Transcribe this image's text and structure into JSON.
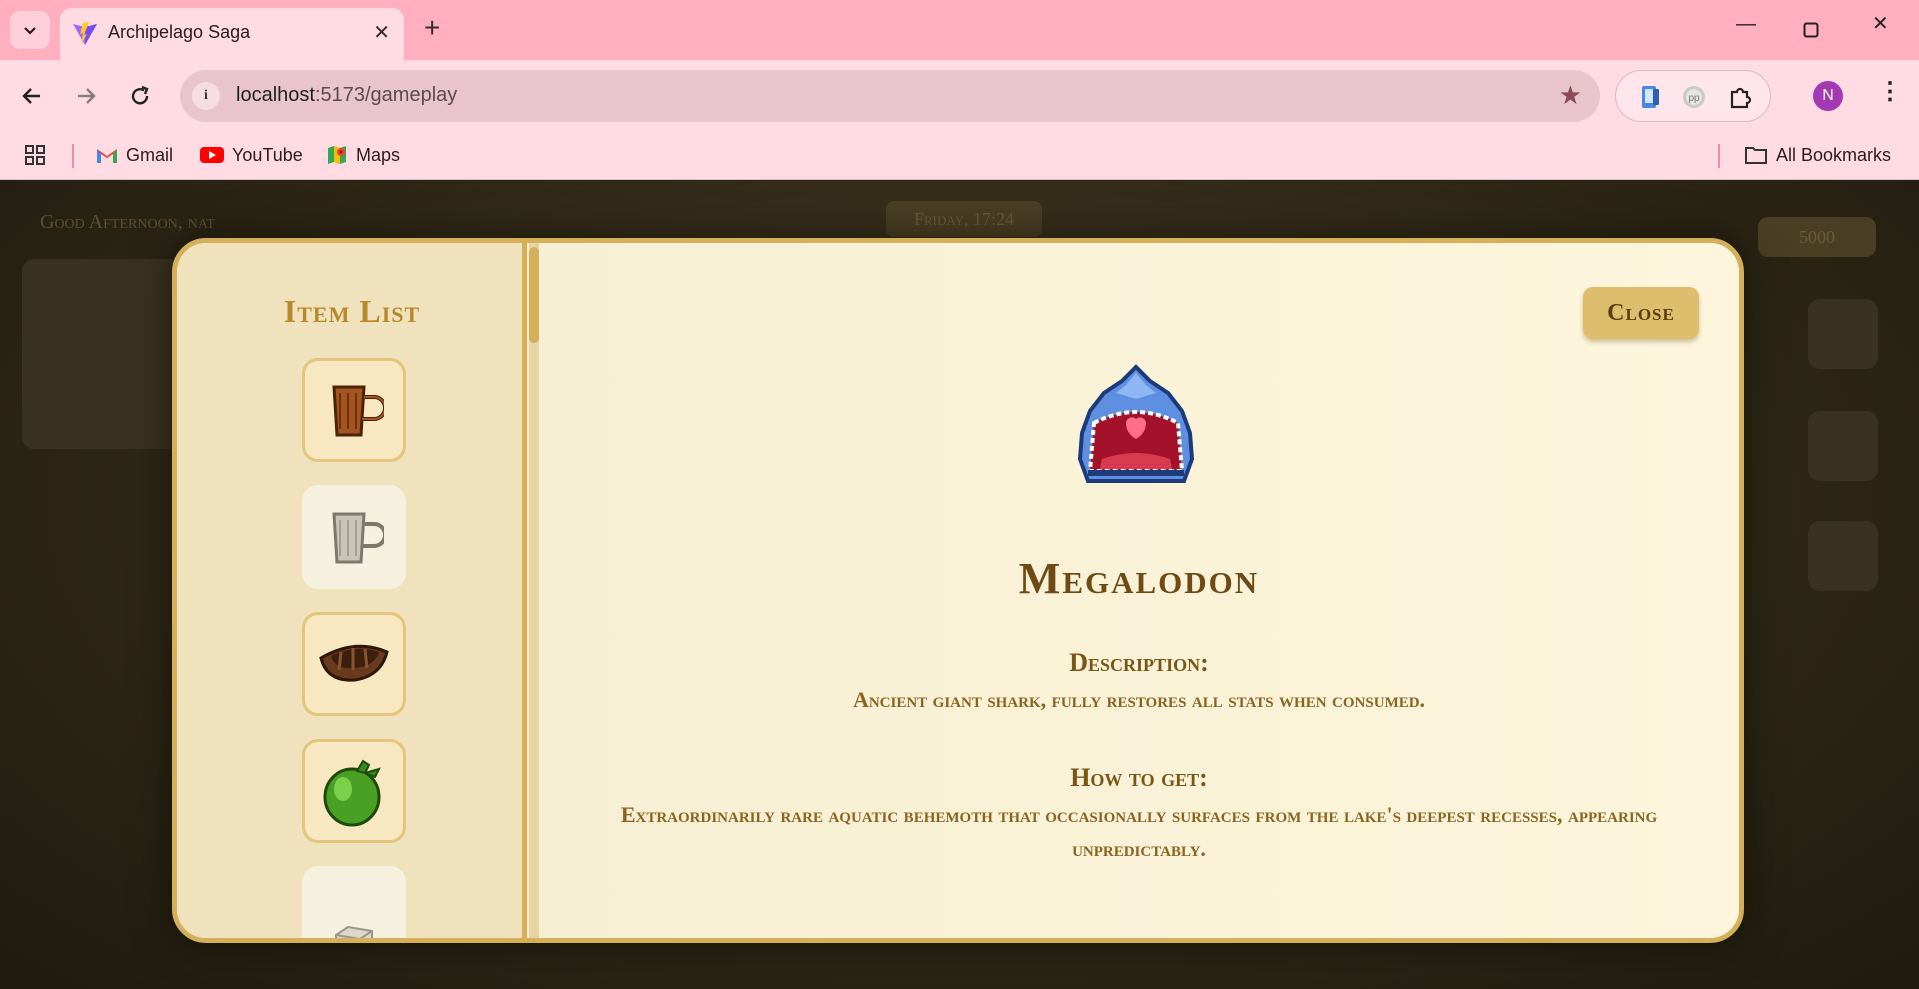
{
  "browser": {
    "tab_title": "Archipelago Saga",
    "url_host": "localhost",
    "url_path": ":5173/gameplay",
    "profile_initial": "N",
    "bookmarks": [
      "Gmail",
      "YouTube",
      "Maps"
    ],
    "all_bookmarks": "All Bookmarks"
  },
  "background": {
    "greeting": "Good Afternoon, nat",
    "date": "Friday, 17:24",
    "gold": "5000"
  },
  "modal": {
    "list_title": "Item List",
    "items": [
      "wooden-mug",
      "silver-mug",
      "wooden-boat",
      "coconut",
      "stone-block"
    ],
    "close_label": "Close",
    "item_name": "Megalodon",
    "description_label": "Description:",
    "description": "Ancient giant shark, fully restores all stats when consumed.",
    "howto_label": "How to get:",
    "howto": "Extraordinarily rare aquatic behemoth that occasionally surfaces from the lake's deepest recesses, appearing unpredictably."
  },
  "colors": {
    "tabbar": "#ffafc0",
    "chrome": "#ffdce4",
    "modal_border": "#d4b05a",
    "modal_bg": "#f6edcf",
    "title_gold": "#b8892a",
    "heading_brown": "#6e4a14"
  }
}
